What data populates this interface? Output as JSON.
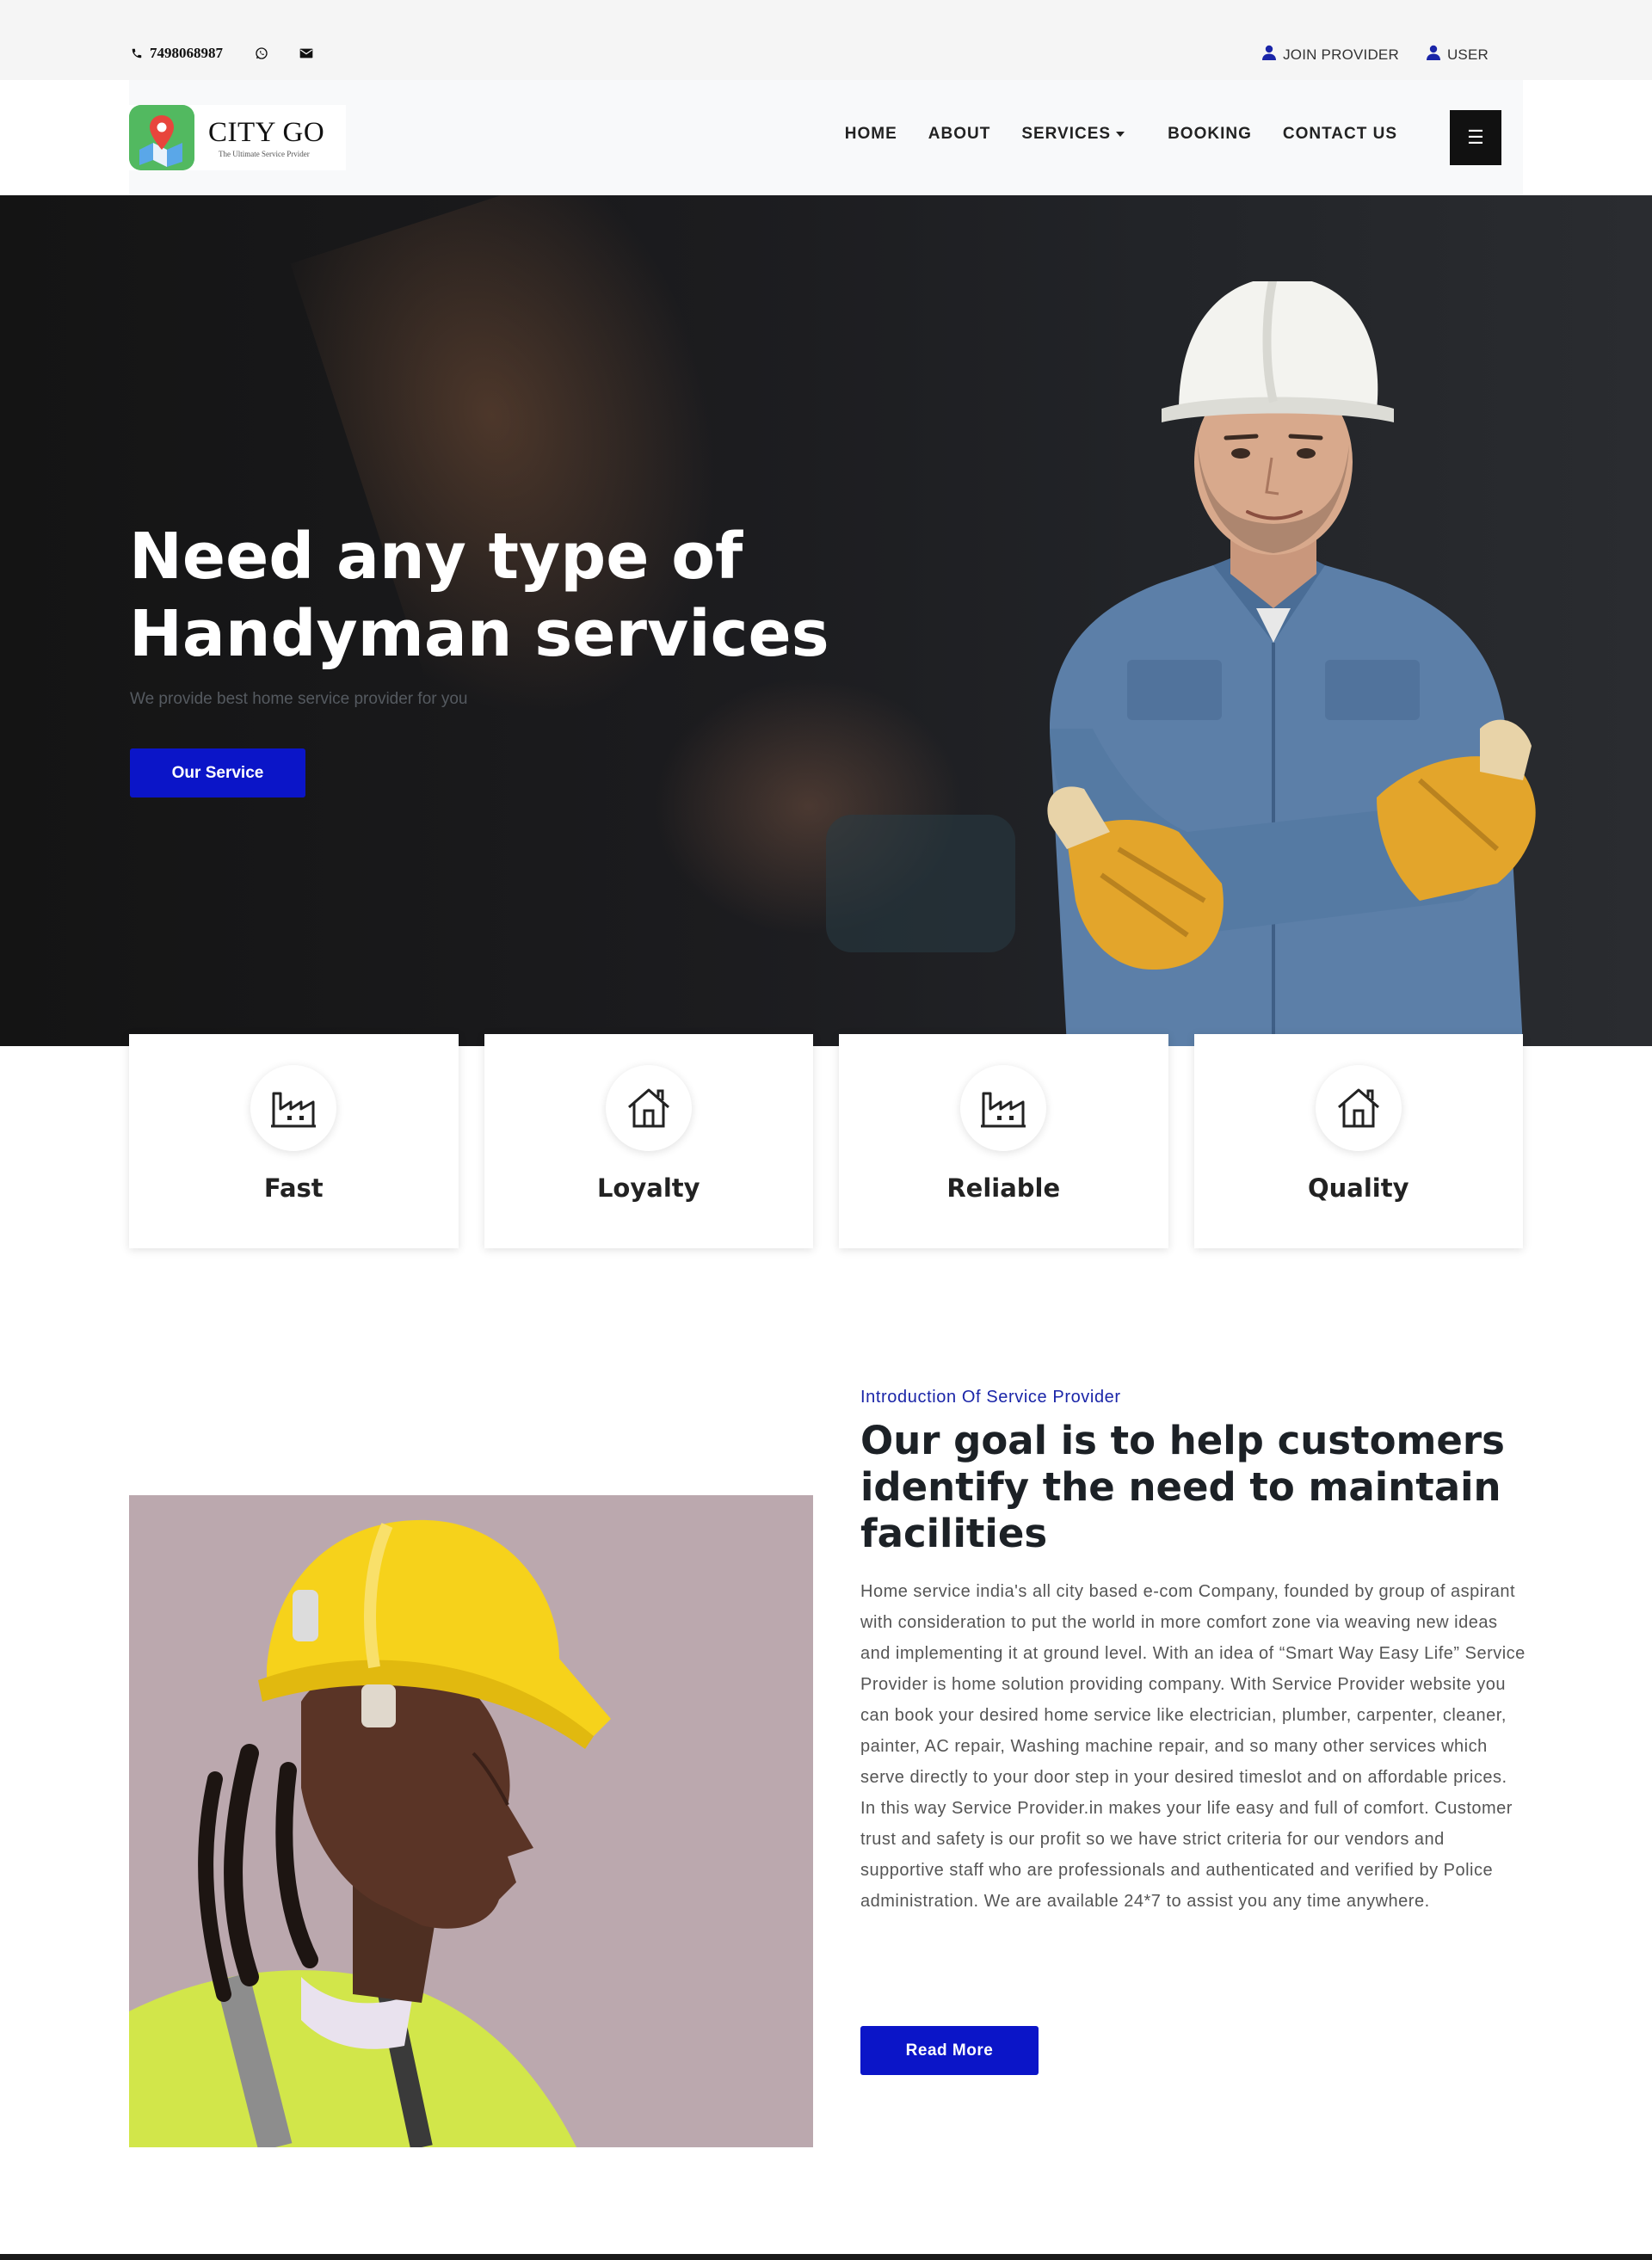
{
  "topbar": {
    "phone": "7498068987",
    "icons": [
      "phone-icon",
      "whatsapp-icon",
      "mail-icon"
    ],
    "links": [
      {
        "label": "JOIN PROVIDER",
        "icon": "user-icon"
      },
      {
        "label": "USER",
        "icon": "user-icon"
      }
    ]
  },
  "logo": {
    "title": "CITY GO",
    "subtitle": "The Ultimate Service Prvider",
    "icon": "map-pin-icon"
  },
  "nav": {
    "items": [
      "HOME",
      "ABOUT",
      "SERVICES",
      "BOOKING",
      "CONTACT US"
    ],
    "menu_glyph": "☰"
  },
  "hero": {
    "title": "Need any type of Handyman services",
    "subtitle": "We provide best home service provider for you",
    "button": "Our Service"
  },
  "features": [
    {
      "label": "Fast",
      "icon": "factory-icon"
    },
    {
      "label": "Loyalty",
      "icon": "home-icon"
    },
    {
      "label": "Reliable",
      "icon": "factory-icon"
    },
    {
      "label": "Quality",
      "icon": "home-icon"
    }
  ],
  "about": {
    "kicker": "Introduction Of Service Provider",
    "title": "Our goal is to help customers identify the need to maintain facilities",
    "text": "Home service india's all city based e-com Company, founded by group of aspirant with consideration to put the world in more comfort zone via weaving new ideas and implementing it at ground level. With an idea of “Smart Way Easy Life” Service Provider is home solution providing company. With Service Provider website you can book your desired home service like electrician, plumber, carpenter, cleaner, painter, AC repair, Washing machine repair, and so many other services which serve directly to your door step in your desired timeslot and on affordable prices. In this way Service Provider.in makes your life easy and full of comfort. Customer trust and safety is our profit so we have strict criteria for our vendors and supportive staff who are professionals and authenticated and verified by Police administration. We are available 24*7 to assist you any time anywhere.",
    "button": "Read More"
  },
  "colors": {
    "accent": "#0b15c8",
    "kicker": "#1a25a8",
    "topbar_bg": "#f5f5f5",
    "nav_bg": "#f8f9fa",
    "logo_green": "#52b960"
  }
}
